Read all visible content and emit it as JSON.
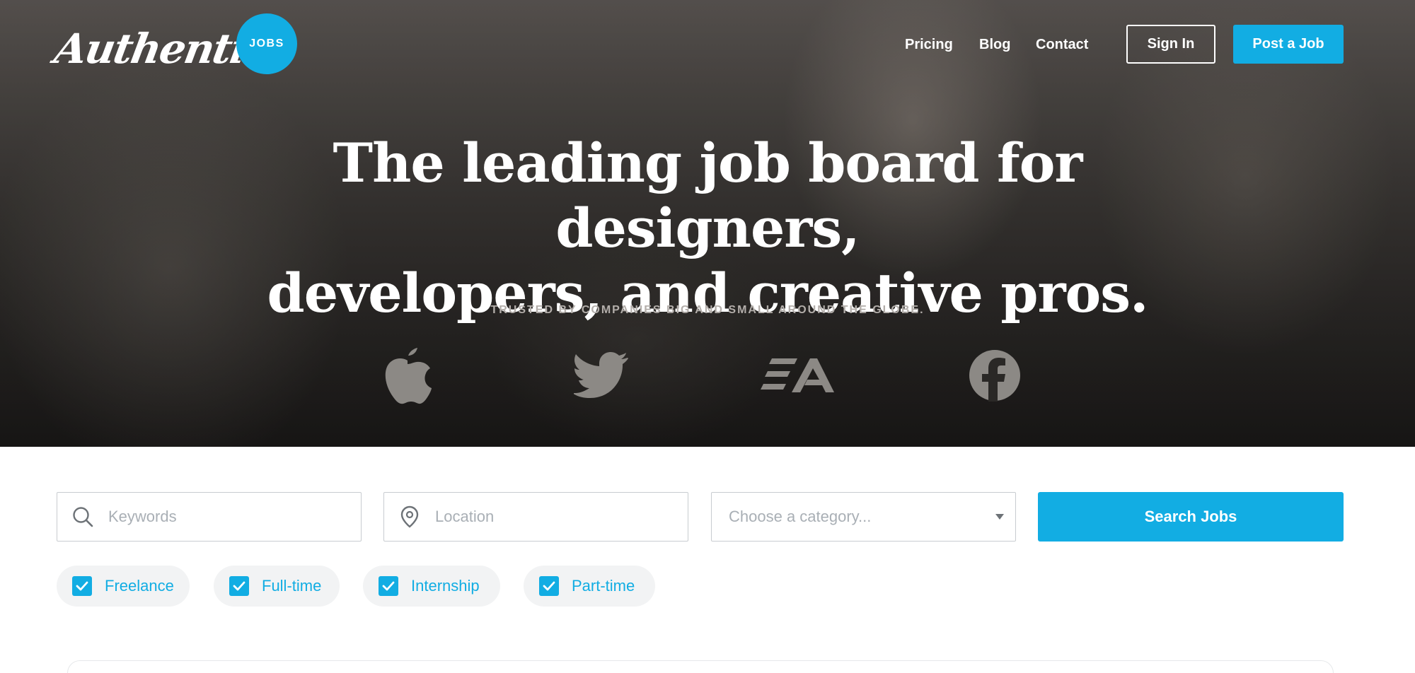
{
  "header": {
    "logo_text": "Authentic",
    "badge": "JOBS",
    "nav": [
      "Pricing",
      "Blog",
      "Contact"
    ],
    "signin_label": "Sign In",
    "post_label": "Post a Job"
  },
  "hero": {
    "headline_line1": "The leading job board for designers,",
    "headline_line2": "developers, and creative pros.",
    "trusted": "TRUSTED BY COMPANIES BIG AND SMALL AROUND THE GLOBE.",
    "brands": [
      "apple-icon",
      "twitter-icon",
      "ea-icon",
      "facebook-icon"
    ]
  },
  "search": {
    "keywords_placeholder": "Keywords",
    "location_placeholder": "Location",
    "category_placeholder": "Choose a category...",
    "button_label": "Search Jobs"
  },
  "filters": [
    {
      "label": "Freelance",
      "checked": true
    },
    {
      "label": "Full-time",
      "checked": true
    },
    {
      "label": "Internship",
      "checked": true
    },
    {
      "label": "Part-time",
      "checked": true
    }
  ],
  "colors": {
    "accent": "#12ade3",
    "hero_dark": "#1e1c1b",
    "placeholder": "#a9afb5",
    "chip_bg": "#f2f3f4"
  }
}
